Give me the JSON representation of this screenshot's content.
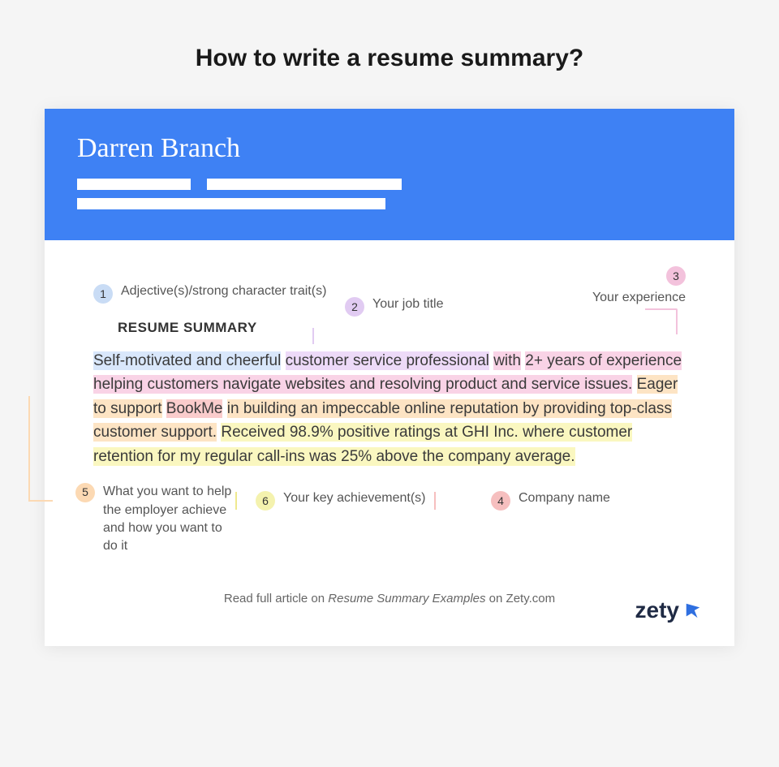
{
  "page_title": "How to write a resume summary?",
  "resume": {
    "name": "Darren Branch",
    "section_title": "RESUME SUMMARY"
  },
  "annotations": {
    "a1": {
      "num": "1",
      "text": "Adjective(s)/strong character trait(s)"
    },
    "a2": {
      "num": "2",
      "text": "Your job title"
    },
    "a3": {
      "num": "3",
      "text": "Your experience"
    },
    "a4": {
      "num": "4",
      "text": "Company name"
    },
    "a5": {
      "num": "5",
      "text": "What you want to help the employer achieve and how you want to do it"
    },
    "a6": {
      "num": "6",
      "text": "Your key achievement(s)"
    }
  },
  "summary_parts": {
    "p1": "Self-motivated and cheerful",
    "p2": "customer service professional",
    "p3_a": "with",
    "p3_b": "2+ years of experience helping customers navigate websites and resolving product and service issues.",
    "p5_a": "Eager to support",
    "p4": "BookMe",
    "p5_b": "in building an impeccable online reputation by providing top-class customer support.",
    "p6": "Received 98.9% positive ratings at GHI Inc. where customer retention for my regular call-ins was 25% above the company average."
  },
  "footer": {
    "prefix": "Read full article on ",
    "link": "Resume Summary Examples",
    "suffix": " on Zety.com"
  },
  "brand": "zety"
}
